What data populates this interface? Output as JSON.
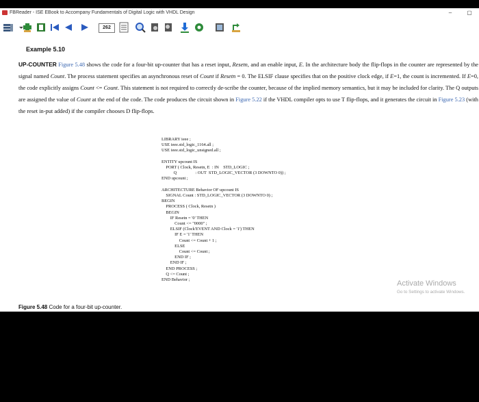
{
  "window": {
    "title": "FBReader - ISE EBook to Accompany Fundamentals of Digital Logic with VHDL Design",
    "minimize": "–",
    "restore": "▢"
  },
  "toolbar": {
    "page_number": "262",
    "icons": [
      "library-icon",
      "add-book-icon",
      "book-info-icon",
      "go-start-icon",
      "back-icon",
      "forward-icon",
      "toc-icon",
      "search-icon",
      "find-next-icon",
      "find-previous-icon",
      "download-icon",
      "settings-icon",
      "network-icon",
      "rotate-icon"
    ]
  },
  "content": {
    "example_heading": "Example 5.10",
    "paragraph": {
      "lead": "UP-COUNTER",
      "s1": " ",
      "ref1": "Figure 5.48",
      "s2": " shows the code for a four-bit up-counter that has a reset input, ",
      "i1": "Resetn",
      "s3": ", and an enable input, ",
      "i2": "E",
      "s4": ". In the architecture body the flip-flops in the counter are represented by the signal named ",
      "i3": "Count",
      "s5": ". The process statement specifies an asynchronous reset of ",
      "i4": "Count",
      "s6": " if ",
      "i5": "Resetn",
      "s7": " = 0. The ELSIF clause specifies that on the positive clock edge, if ",
      "i6": "E",
      "s8": "=1, the count is incremented. If ",
      "i7": "E",
      "s9": "=0, the code explicitly assigns ",
      "i8": "Count",
      "s10": " <= ",
      "i9": "Count",
      "s11": ". This statement is not required to correctly de-scribe the counter, because of the implied memory semantics, but it may be included for clarity. The Q outputs are assigned the value of ",
      "i10": "Count",
      "s12": " at the end of the code. The code produces the circuit shown in ",
      "ref2": "Figure 5.22",
      "s13": " if the VHDL compiler opts to use T flip-flops, and it generates the circuit in ",
      "ref3": "Figure 5.23",
      "s14": " (with the reset in-put added) if the compiler chooses D flip-flops."
    },
    "code": "LIBRARY ieee ;\nUSE ieee.std_logic_1164.all ;\nUSE ieee.std_logic_unsigned.all ;\n\nENTITY upcount IS\n    PORT ( Clock, Resetn, E  : IN    STD_LOGIC ;\n           Q                 : OUT  STD_LOGIC_VECTOR (3 DOWNTO 0)) ;\nEND upcount ;\n\nARCHITECTURE Behavior OF upcount IS\n    SIGNAL Count : STD_LOGIC_VECTOR (3 DOWNTO 0) ;\nBEGIN\n    PROCESS ( Clock, Resetn )\n    BEGIN\n        IF Resetn = '0' THEN\n            Count <= \"0000\" ;\n        ELSIF (Clock'EVENT AND Clock = '1') THEN\n            IF E = '1' THEN\n                Count <= Count + 1 ;\n            ELSE\n                Count <= Count ;\n            END IF ;\n        END IF ;\n    END PROCESS ;\n    Q <= Count ;\nEND Behavior ;",
    "caption_label": "Figure 5.48",
    "caption_text": " Code for a four-bit up-counter."
  },
  "watermark": {
    "title": "Activate Windows",
    "subtitle": "Go to Settings to activate Windows."
  }
}
